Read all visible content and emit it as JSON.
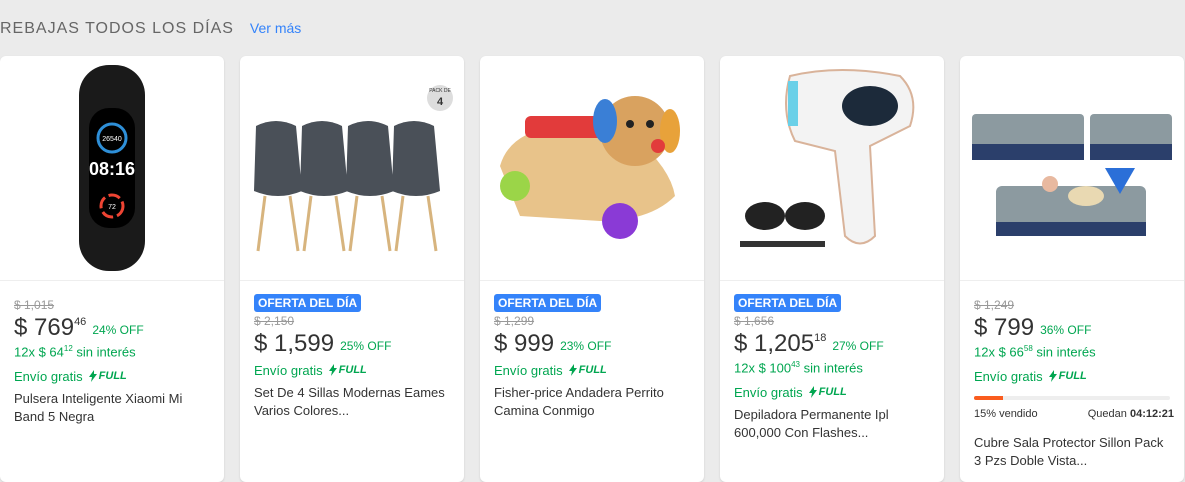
{
  "section": {
    "title": "REBAJAS TODOS LOS DÍAS",
    "see_more": "Ver más"
  },
  "full_label": "FULL",
  "products": [
    {
      "badge": "",
      "old_price": "$ 1,015",
      "price": "$ 769",
      "cents": "46",
      "discount": "24% OFF",
      "installments_prefix": "12x $ 64",
      "installments_cents": "12",
      "installments_suffix": " sin interés",
      "shipping": "Envío gratis",
      "name": "Pulsera Inteligente Xiaomi Mi Band 5 Negra",
      "image": "smart-band-image"
    },
    {
      "badge": "OFERTA DEL DÍA",
      "old_price": "$ 2,150",
      "price": "$ 1,599",
      "cents": "",
      "discount": "25% OFF",
      "installments_prefix": "",
      "installments_cents": "",
      "installments_suffix": "",
      "shipping": "Envío gratis",
      "name": "Set De 4 Sillas Modernas Eames Varios Colores...",
      "image": "chairs-image",
      "pack_label": "PACK DE",
      "pack_number": "4"
    },
    {
      "badge": "OFERTA DEL DÍA",
      "old_price": "$ 1,299",
      "price": "$ 999",
      "cents": "",
      "discount": "23% OFF",
      "installments_prefix": "",
      "installments_cents": "",
      "installments_suffix": "",
      "shipping": "Envío gratis",
      "name": "Fisher-price Andadera Perrito Camina Conmigo",
      "image": "toy-walker-image"
    },
    {
      "badge": "OFERTA DEL DÍA",
      "old_price": "$ 1,656",
      "price": "$ 1,205",
      "cents": "18",
      "discount": "27% OFF",
      "installments_prefix": "12x $ 100",
      "installments_cents": "43",
      "installments_suffix": " sin interés",
      "shipping": "Envío gratis",
      "name": "Depiladora Permanente Ipl 600,000 Con Flashes...",
      "image": "ipl-device-image"
    },
    {
      "badge": "",
      "old_price": "$ 1,249",
      "price": "$ 799",
      "cents": "",
      "discount": "36% OFF",
      "installments_prefix": "12x $ 66",
      "installments_cents": "58",
      "installments_suffix": " sin interés",
      "shipping": "Envío gratis",
      "name": "Cubre Sala Protector Sillon Pack 3 Pzs Doble Vista...",
      "image": "sofa-cover-image",
      "sold_text": "15% vendido",
      "sold_fraction": 0.15,
      "timer_label": "Quedan",
      "timer_value": "04:12:21"
    }
  ],
  "colors": {
    "accent": "#3483fa",
    "green": "#00a650",
    "orange": "#fa5c1e"
  }
}
